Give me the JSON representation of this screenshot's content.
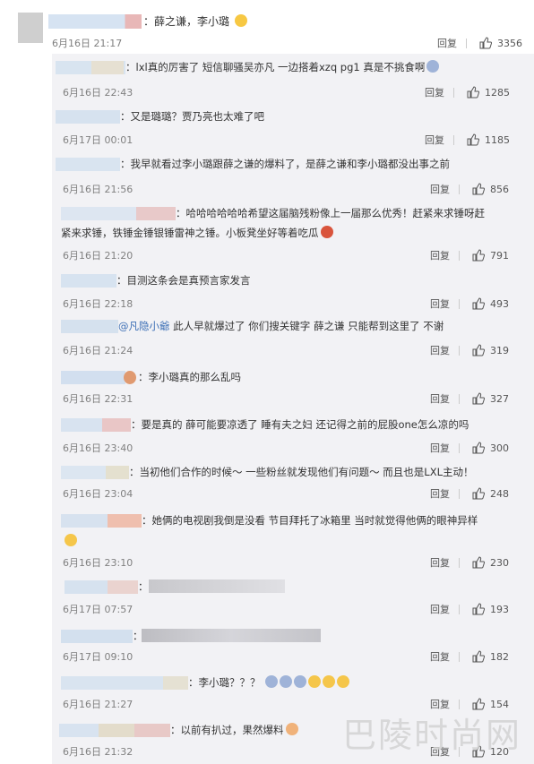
{
  "top_comment": {
    "text": "：薛之谦，李小璐",
    "date": "6月16日 21:17",
    "reply_label": "回复",
    "likes": "3356"
  },
  "replies": [
    {
      "text": "：lxl真的厉害了 短信聊骚吴亦凡 一边搭着xzq pg1 真是不挑食啊",
      "date": "6月16日 22:43",
      "reply_label": "回复",
      "likes": "1285"
    },
    {
      "text": "：又是璐璐？贾乃亮也太难了吧",
      "date": "6月17日 00:01",
      "reply_label": "回复",
      "likes": "1185"
    },
    {
      "text": "：我早就看过李小璐跟薛之谦的爆料了，是薛之谦和李小璐都没出事之前",
      "date": "6月16日 21:56",
      "reply_label": "回复",
      "likes": "856"
    },
    {
      "text_line1": "：哈哈哈哈哈哈希望这届脑残粉像上一届那么优秀！赶紧来求锤呀赶",
      "text_line2": "紧来求锤，铁锤金锤银锤雷神之锤。小板凳坐好等着吃瓜",
      "date": "6月16日 21:20",
      "reply_label": "回复",
      "likes": "791"
    },
    {
      "text": "：目测这条会是真预言家发言",
      "date": "6月16日 22:18",
      "reply_label": "回复",
      "likes": "493"
    },
    {
      "mention": "@凡隐小爺",
      "text": " 此人早就爆过了 你们搜关键字 薛之谦 只能帮到这里了 不谢",
      "date": "6月16日 21:24",
      "reply_label": "回复",
      "likes": "319"
    },
    {
      "text": "：李小璐真的那么乱吗",
      "date": "6月16日 22:31",
      "reply_label": "回复",
      "likes": "327"
    },
    {
      "text": "：要是真的 薛可能要凉透了 睡有夫之妇  还记得之前的屁股one怎么凉的吗",
      "date": "6月16日 23:40",
      "reply_label": "回复",
      "likes": "300"
    },
    {
      "text": "：当初他们合作的时候～ 一些粉丝就发现他们有问题～ 而且也是LXL主动！",
      "date": "6月16日 23:04",
      "reply_label": "回复",
      "likes": "248"
    },
    {
      "text": "：她俩的电视剧我倒是没看 节目拜托了冰箱里 当时就觉得他俩的眼神异样",
      "date": "6月16日 23:10",
      "reply_label": "回复",
      "likes": "230"
    },
    {
      "text": "：",
      "date": "6月17日 07:57",
      "reply_label": "回复",
      "likes": "193"
    },
    {
      "text": "：",
      "date": "6月17日 09:10",
      "reply_label": "回复",
      "likes": "182"
    },
    {
      "text": "：李小璐？？？",
      "date": "6月16日 21:27",
      "reply_label": "回复",
      "likes": "154"
    },
    {
      "text": "：以前有扒过，果然爆料",
      "date": "6月16日 21:32",
      "reply_label": "回复",
      "likes": "120"
    }
  ],
  "watermark": "巴陵时尚网",
  "colors": {
    "background": "#ffffff",
    "reply_panel": "#f2f2f5",
    "link": "#3b6eb5",
    "meta": "#808080"
  },
  "icons": {
    "like": "thumb-up-icon"
  }
}
